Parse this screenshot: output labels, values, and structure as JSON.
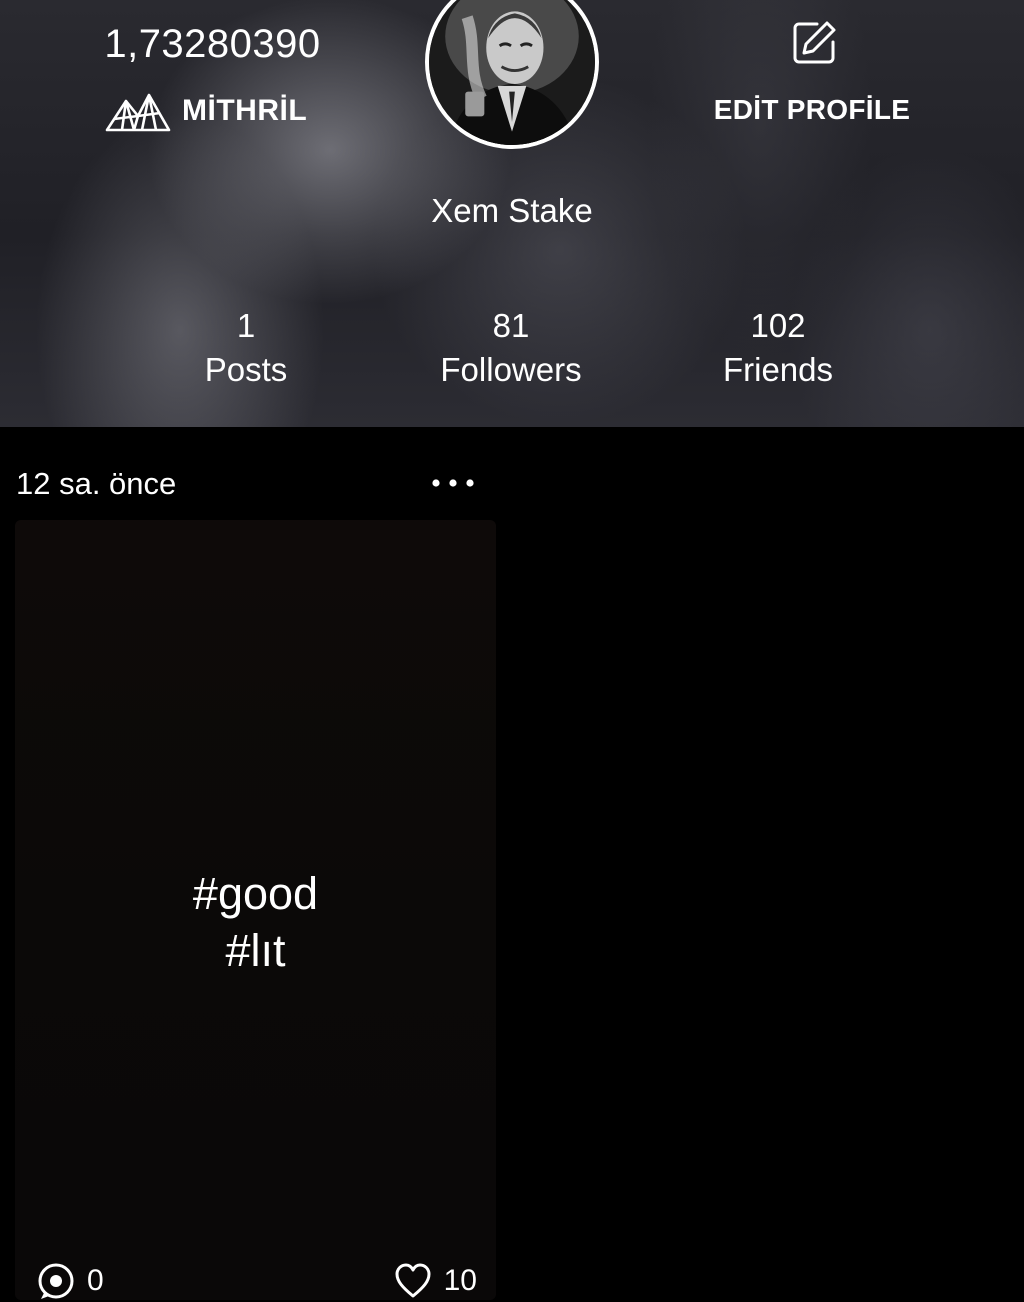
{
  "profile": {
    "balance": "1,73280390",
    "tier_label": "MİTHRİL",
    "username": "Xem Stake",
    "edit_label": "EDİT PROFİLE"
  },
  "stats": {
    "posts": {
      "value": "1",
      "label": "Posts"
    },
    "followers": {
      "value": "81",
      "label": "Followers"
    },
    "friends": {
      "value": "102",
      "label": "Friends"
    }
  },
  "post": {
    "time": "12 sa. önce",
    "line1": "#good",
    "line2": "#lıt",
    "comment_count": "0",
    "like_count": "10"
  },
  "icons": {
    "tier": "mountain-icon",
    "edit": "edit-icon",
    "menu": "more-horizontal-icon",
    "comment": "comment-icon",
    "like": "heart-icon"
  },
  "colors": {
    "background": "#000000",
    "text": "#ffffff",
    "post_card": "#0c0908"
  }
}
